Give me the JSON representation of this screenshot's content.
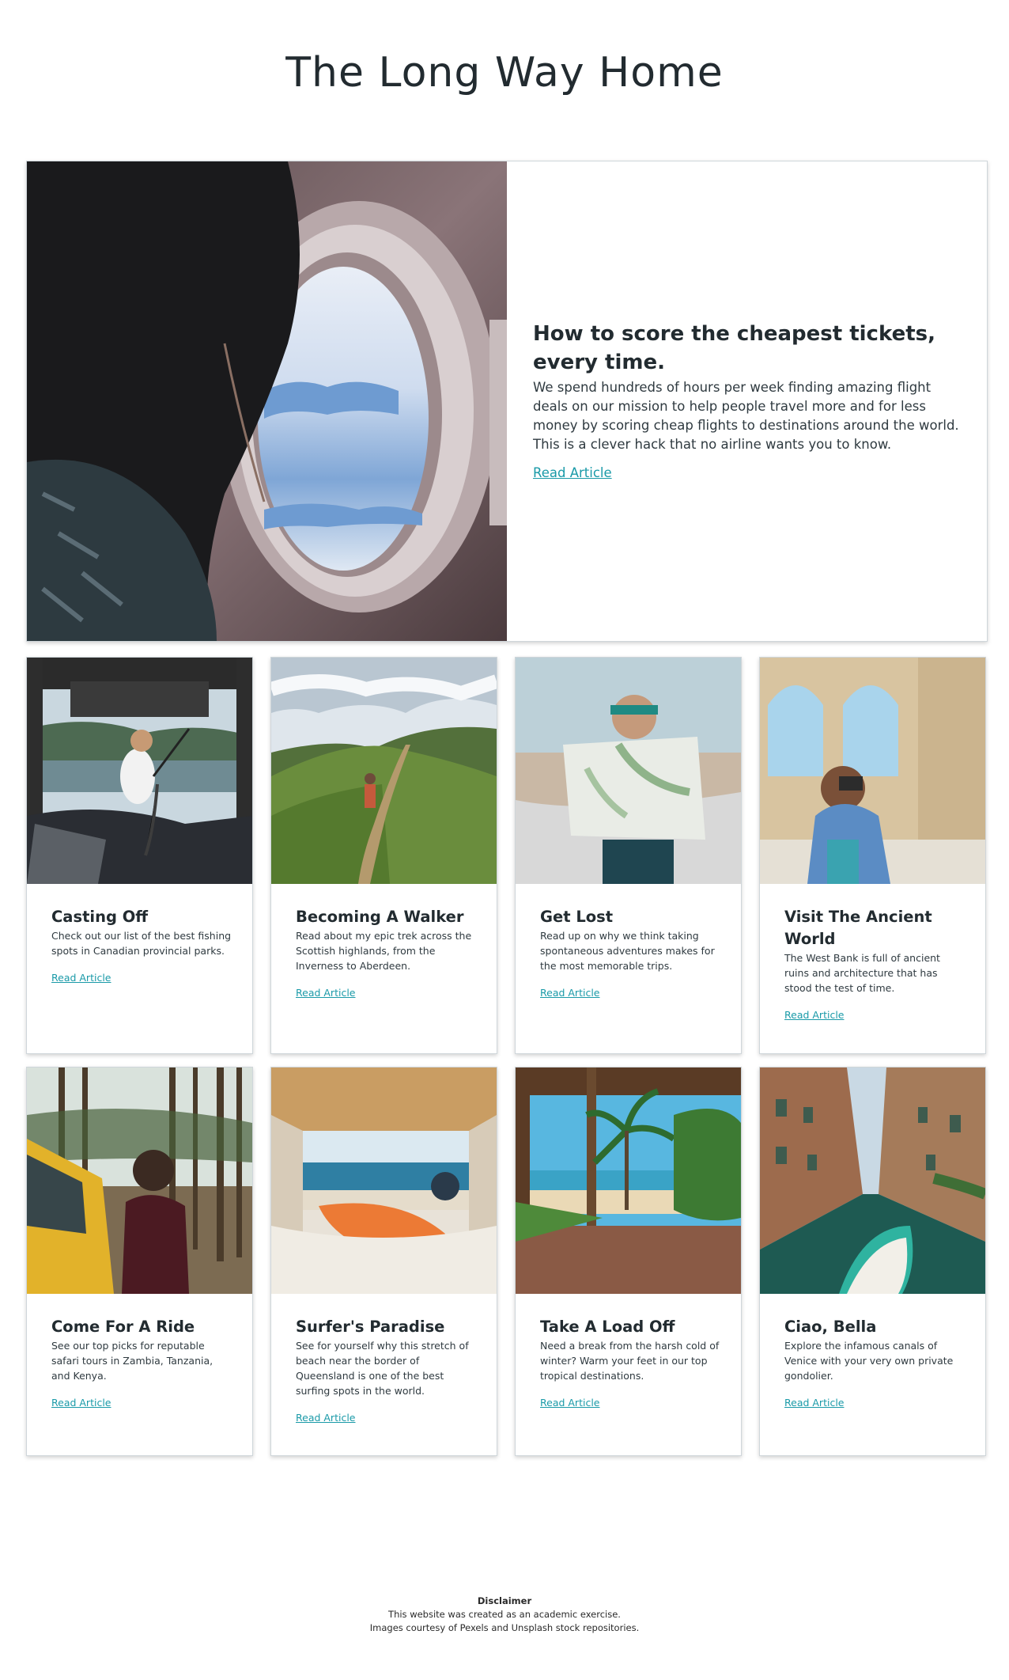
{
  "site": {
    "title": "The Long Way Home"
  },
  "hero": {
    "title": "How to score the cheapest tickets, every time.",
    "text": "We spend hundreds of hours per week finding amazing flight deals on our mission to help people travel more and for less money by scoring cheap flights to destinations around the world. This is a clever hack that no airline wants you to know.",
    "link": "Read Article"
  },
  "articles": [
    {
      "title": "Casting Off",
      "text": "Check out our list of the best fishing spots in Canadian provincial parks.",
      "link": "Read Article"
    },
    {
      "title": "Becoming A Walker",
      "text": "Read about my epic trek across the Scottish highlands, from the Inverness to Aberdeen.",
      "link": "Read Article"
    },
    {
      "title": "Get Lost",
      "text": "Read up on why we think taking spontaneous adventures makes for the most memorable trips.",
      "link": "Read Article"
    },
    {
      "title": "Visit The Ancient World",
      "text": "The West Bank is full of ancient ruins and architecture that has stood the test of time.",
      "link": "Read Article"
    },
    {
      "title": "Come For A Ride",
      "text": "See our top picks for reputable safari tours in Zambia, Tanzania, and Kenya.",
      "link": "Read Article"
    },
    {
      "title": "Surfer's Paradise",
      "text": "See for yourself why this stretch of beach near the border of Queensland is one of the best surfing spots in the world.",
      "link": "Read Article"
    },
    {
      "title": "Take A Load Off",
      "text": "Need a break from the harsh cold of winter? Warm your feet in our top tropical destinations.",
      "link": "Read Article"
    },
    {
      "title": "Ciao, Bella",
      "text": "Explore the infamous canals of Venice with your very own private gondolier.",
      "link": "Read Article"
    }
  ],
  "footer": {
    "title": "Disclaimer",
    "line1": "This website was created as an academic exercise.",
    "line2": "Images courtesy of Pexels and Unsplash stock repositories."
  },
  "colors": {
    "link": "#1a9aa8",
    "text": "#222b30"
  }
}
